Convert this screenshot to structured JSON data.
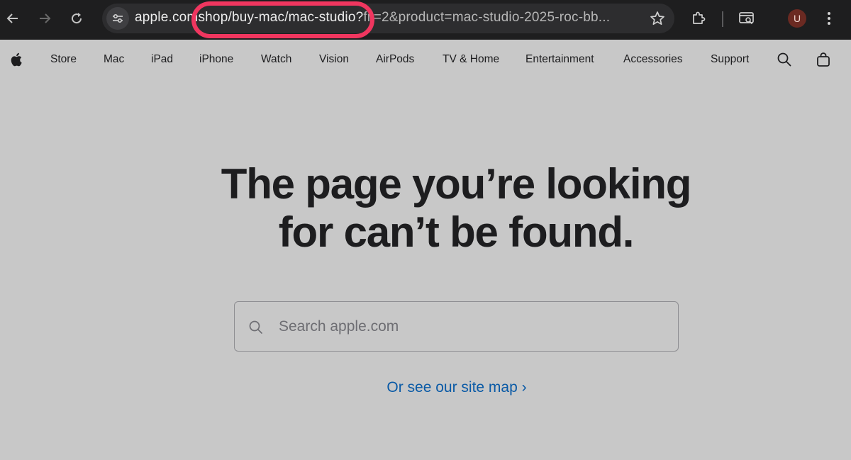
{
  "browser": {
    "url_host": "apple.com",
    "url_path_highlight": "shop/buy-mac/mac-studio?",
    "url_rest": "fil=2&product=mac-studio-2025-roc-bb...",
    "avatar_letter": "U",
    "highlight_color": "#f0365f",
    "icons": [
      "back-arrow-icon",
      "forward-arrow-icon",
      "reload-icon",
      "site-info-icon",
      "bookmark-star-icon",
      "extensions-icon",
      "search-tab-icon",
      "kebab-menu-icon"
    ]
  },
  "nav": {
    "items": [
      "Store",
      "Mac",
      "iPad",
      "iPhone",
      "Watch",
      "Vision",
      "AirPods",
      "TV & Home",
      "Entertainment",
      "Accessories",
      "Support"
    ],
    "icons": [
      "apple-logo-icon",
      "search-icon",
      "bag-icon"
    ]
  },
  "main": {
    "headline_line1": "The page you’re looking",
    "headline_line2": "for can’t be found.",
    "search_placeholder": "Search apple.com",
    "sitemap_link": "Or see our site map ›",
    "link_color": "#0a5aa6"
  }
}
